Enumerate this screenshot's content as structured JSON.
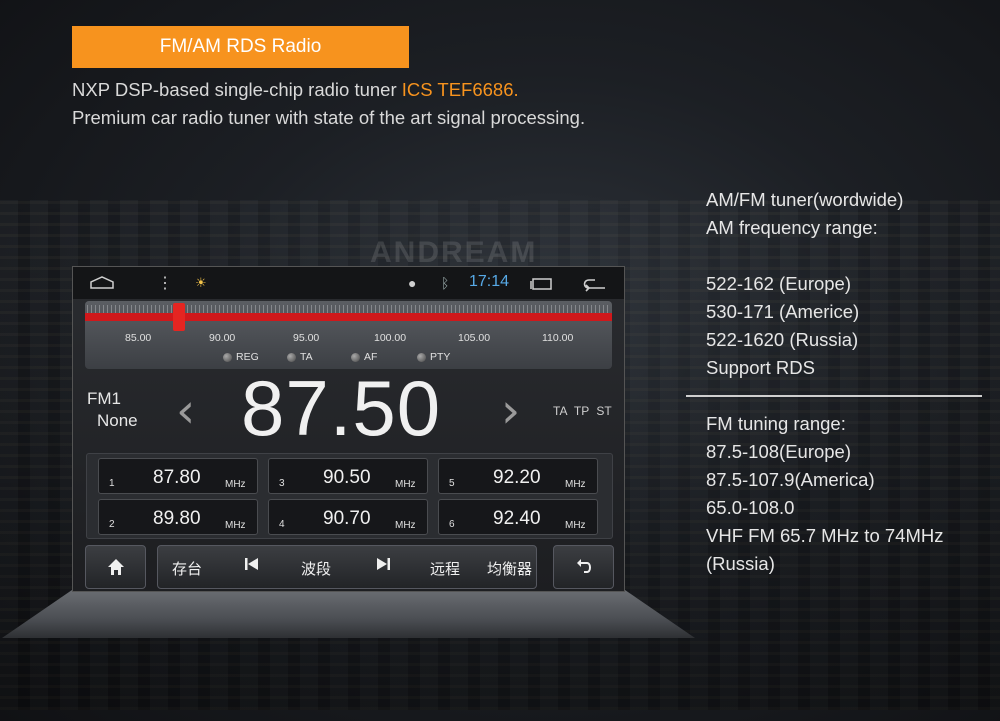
{
  "banner": {
    "title": "FM/AM RDS Radio"
  },
  "intro": {
    "line1_prefix": "NXP DSP-based single-chip radio tuner ",
    "line1_accent": "ICS TEF6686.",
    "line2": "Premium car radio tuner with state of the art signal processing."
  },
  "watermark": "ANDREAM",
  "specs": {
    "am_header1": "AM/FM tuner(wordwide)",
    "am_header2": "AM frequency range:",
    "am_ranges": [
      "522-162 (Europe)",
      "530-171 (Americe)",
      "522-1620 (Russia)",
      "Support RDS"
    ],
    "fm_header": "FM tuning range:",
    "fm_ranges": [
      "87.5-108(Europe)",
      "87.5-107.9(America)",
      "65.0-108.0",
      "VHF FM 65.7 MHz to 74MHz",
      "(Russia)"
    ]
  },
  "screen": {
    "status": {
      "time": "17:14"
    },
    "tuner": {
      "scale_labels": [
        "85.00",
        "90.00",
        "95.00",
        "100.00",
        "105.00",
        "110.00"
      ],
      "options": [
        "REG",
        "TA",
        "AF",
        "PTY"
      ]
    },
    "band": "FM1",
    "ps": "None",
    "frequency": "87.50",
    "flags": "TA TP ST",
    "presets": [
      {
        "num": "1",
        "value": "87.80",
        "unit": "MHz"
      },
      {
        "num": "3",
        "value": "90.50",
        "unit": "MHz"
      },
      {
        "num": "5",
        "value": "92.20",
        "unit": "MHz"
      },
      {
        "num": "2",
        "value": "89.80",
        "unit": "MHz"
      },
      {
        "num": "4",
        "value": "90.70",
        "unit": "MHz"
      },
      {
        "num": "6",
        "value": "92.40",
        "unit": "MHz"
      }
    ],
    "toolbar": {
      "save": "存台",
      "band": "波段",
      "distance": "远程",
      "eq": "均衡器"
    }
  }
}
